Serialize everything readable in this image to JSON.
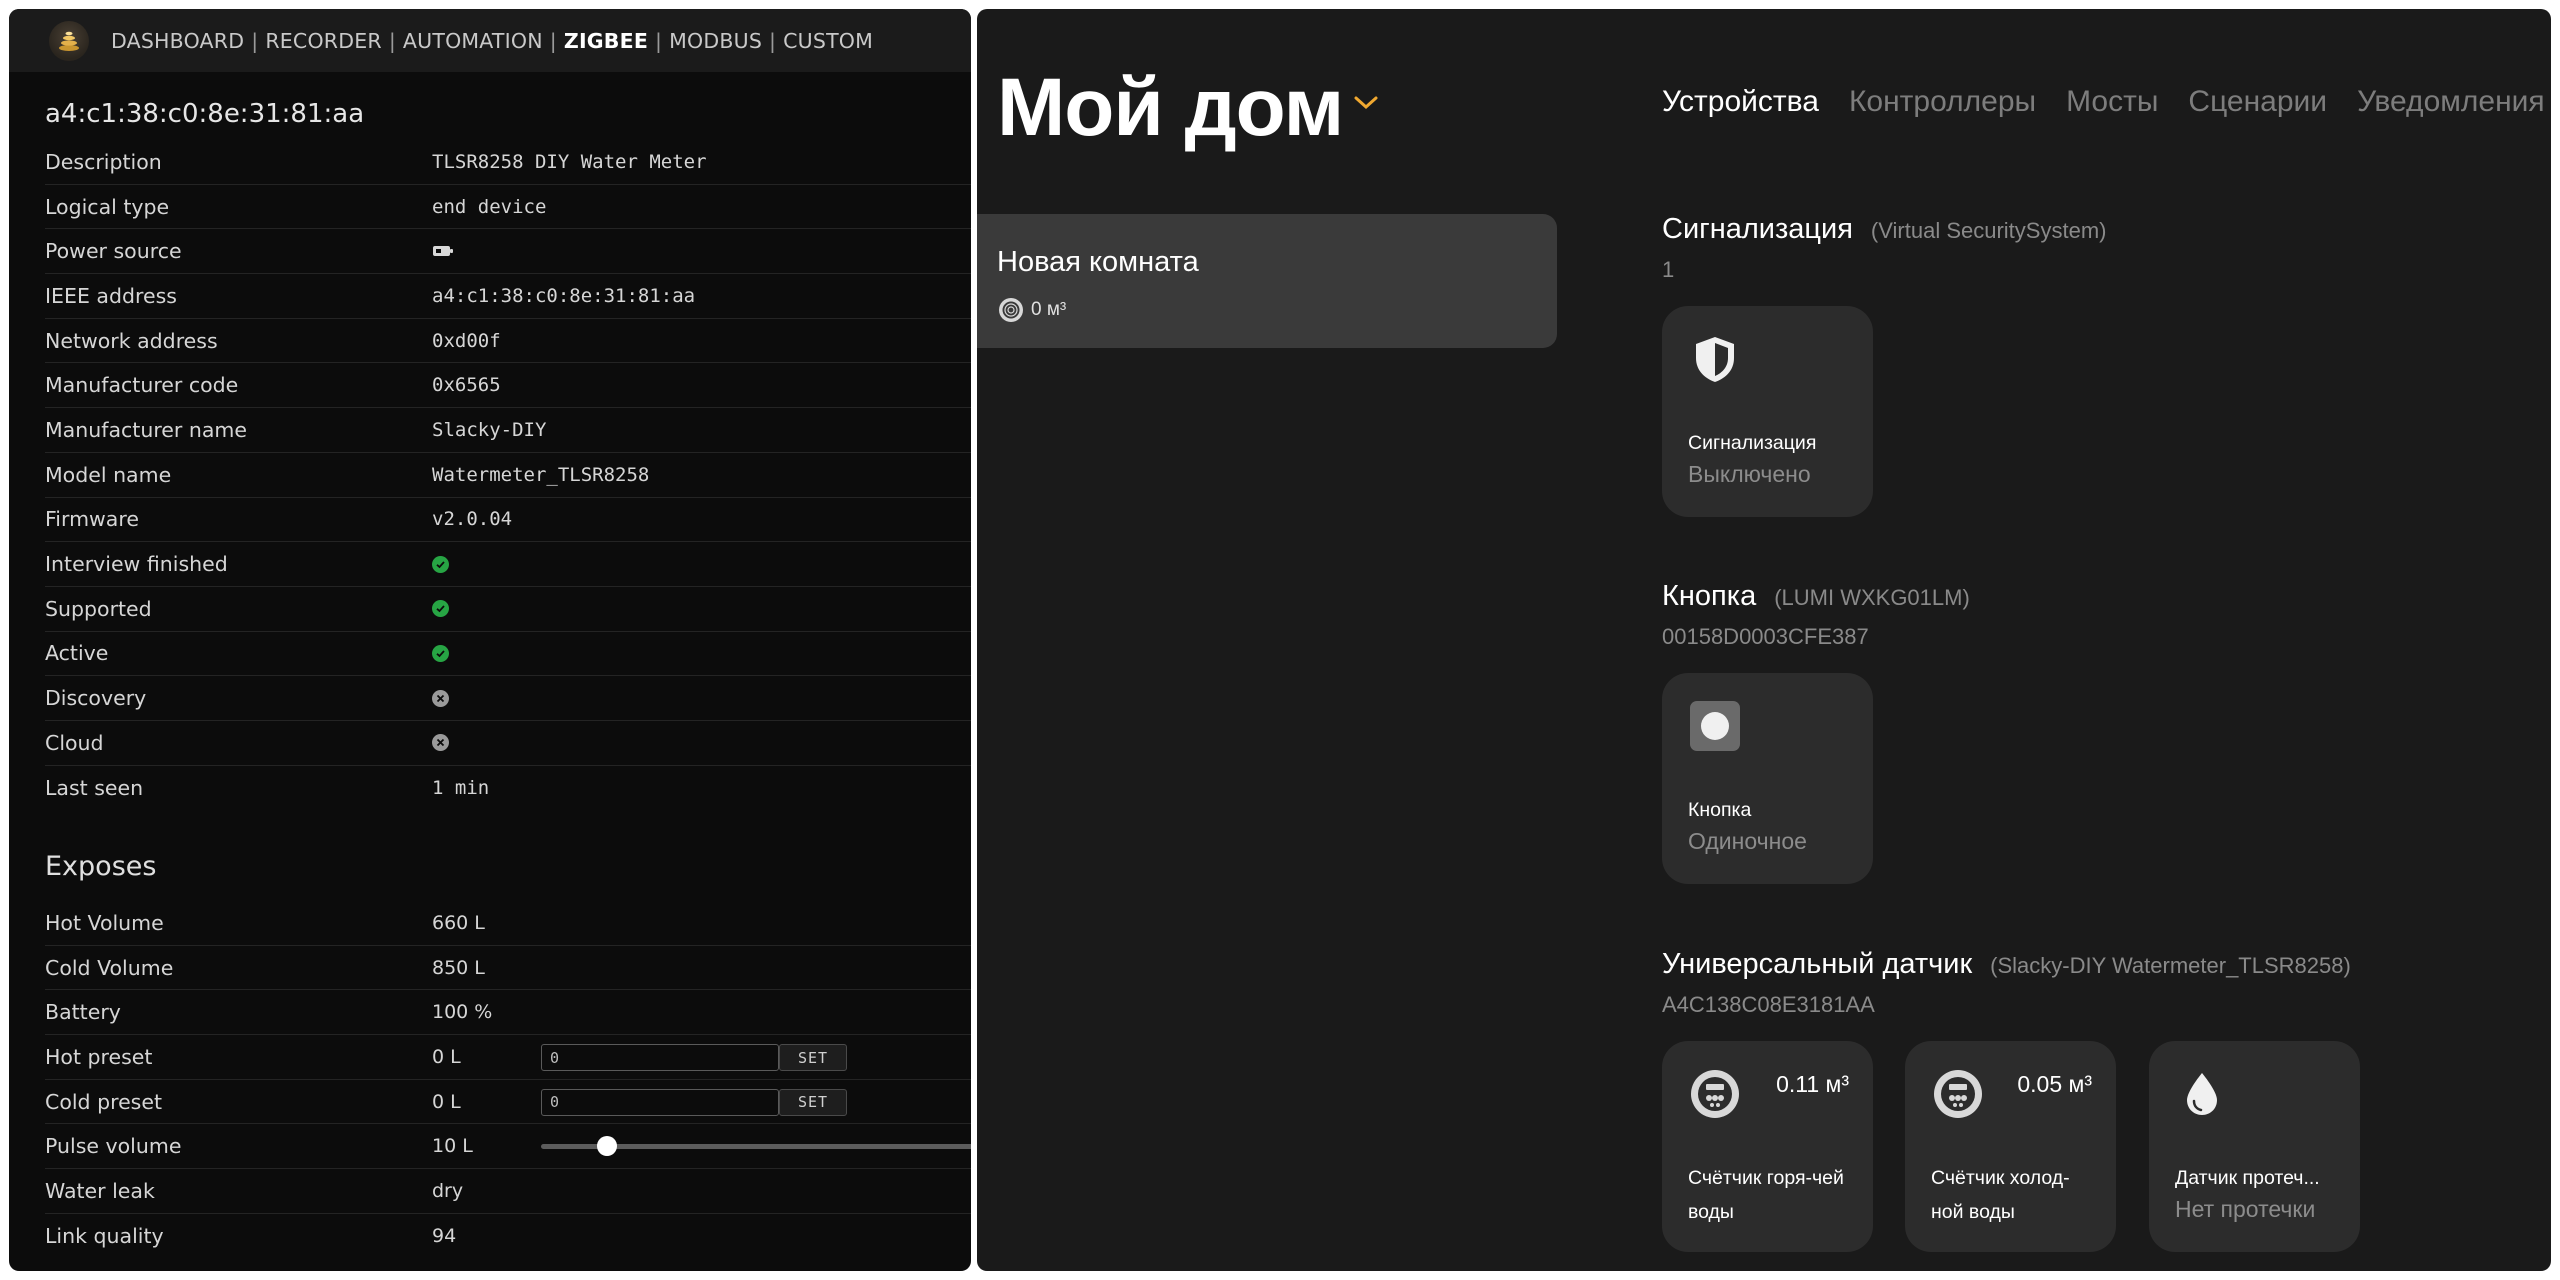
{
  "left": {
    "nav": {
      "items": [
        "DASHBOARD",
        "RECORDER",
        "AUTOMATION",
        "ZIGBEE",
        "MODBUS",
        "CUSTOM"
      ],
      "separator": "|",
      "active": "ZIGBEE"
    },
    "device_title": "a4:c1:38:c0:8e:31:81:aa",
    "properties": [
      {
        "label": "Description",
        "value": "TLSR8258 DIY Water Meter"
      },
      {
        "label": "Logical type",
        "value": "end device"
      },
      {
        "label": "Power source",
        "value": "",
        "icon": "battery-icon"
      },
      {
        "label": "IEEE address",
        "value": "a4:c1:38:c0:8e:31:81:aa"
      },
      {
        "label": "Network address",
        "value": "0xd00f"
      },
      {
        "label": "Manufacturer code",
        "value": "0x6565"
      },
      {
        "label": "Manufacturer name",
        "value": "Slacky-DIY"
      },
      {
        "label": "Model name",
        "value": "Watermeter_TLSR8258"
      },
      {
        "label": "Firmware",
        "value": "v2.0.04"
      },
      {
        "label": "Interview finished",
        "value": "",
        "icon": "check-icon"
      },
      {
        "label": "Supported",
        "value": "",
        "icon": "check-icon"
      },
      {
        "label": "Active",
        "value": "",
        "icon": "check-icon"
      },
      {
        "label": "Discovery",
        "value": "",
        "icon": "cross-icon"
      },
      {
        "label": "Cloud",
        "value": "",
        "icon": "cross-icon"
      },
      {
        "label": "Last seen",
        "value": "1 min"
      }
    ],
    "exposes_title": "Exposes",
    "exposes": [
      {
        "label": "Hot Volume",
        "value": "660 L"
      },
      {
        "label": "Cold Volume",
        "value": "850 L"
      },
      {
        "label": "Battery",
        "value": "100 %"
      },
      {
        "label": "Hot preset",
        "value": "0 L",
        "input": "0",
        "button": "SET"
      },
      {
        "label": "Cold preset",
        "value": "0 L",
        "input": "0",
        "button": "SET"
      },
      {
        "label": "Pulse volume",
        "value": "10 L",
        "slider": 0.15
      },
      {
        "label": "Water leak",
        "value": "dry"
      },
      {
        "label": "Link quality",
        "value": "94"
      }
    ],
    "colors": {
      "check": "#27a544",
      "cross": "#9a9a9a",
      "background": "#0c0c0c"
    }
  },
  "right": {
    "home_title": "Мой дом",
    "tabs": [
      "Устройства",
      "Контроллеры",
      "Мосты",
      "Сценарии",
      "Уведомления"
    ],
    "active_tab": "Устройства",
    "room": {
      "name": "Новая комната",
      "meter": "0 м³"
    },
    "groups": [
      {
        "name": "Сигнализация",
        "model": "(Virtual SecuritySystem)",
        "id": "1",
        "cards": [
          {
            "icon": "shield-icon",
            "name": "Сигнализация",
            "state": "Выключено"
          }
        ]
      },
      {
        "name": "Кнопка",
        "model": "(LUMI WXKG01LM)",
        "id": "00158D0003CFE387",
        "cards": [
          {
            "icon": "button-icon",
            "name": "Кнопка",
            "state": "Одиночное"
          }
        ]
      },
      {
        "name": "Универсальный датчик",
        "model": "(Slacky-DIY Watermeter_TLSR8258)",
        "id": "A4C138C08E3181AA",
        "cards": [
          {
            "icon": "water-meter-icon",
            "value": "0.11 м³",
            "name": "Счётчик горя-чей воды"
          },
          {
            "icon": "water-meter-icon",
            "value": "0.05 м³",
            "name": "Счётчик холод-ной воды"
          },
          {
            "icon": "water-drop-icon",
            "name": "Датчик протеч...",
            "state": "Нет протечки"
          }
        ]
      }
    ],
    "colors": {
      "accent": "#f0a830",
      "background": "#1a1a1a",
      "card": "#2c2c2c"
    }
  }
}
